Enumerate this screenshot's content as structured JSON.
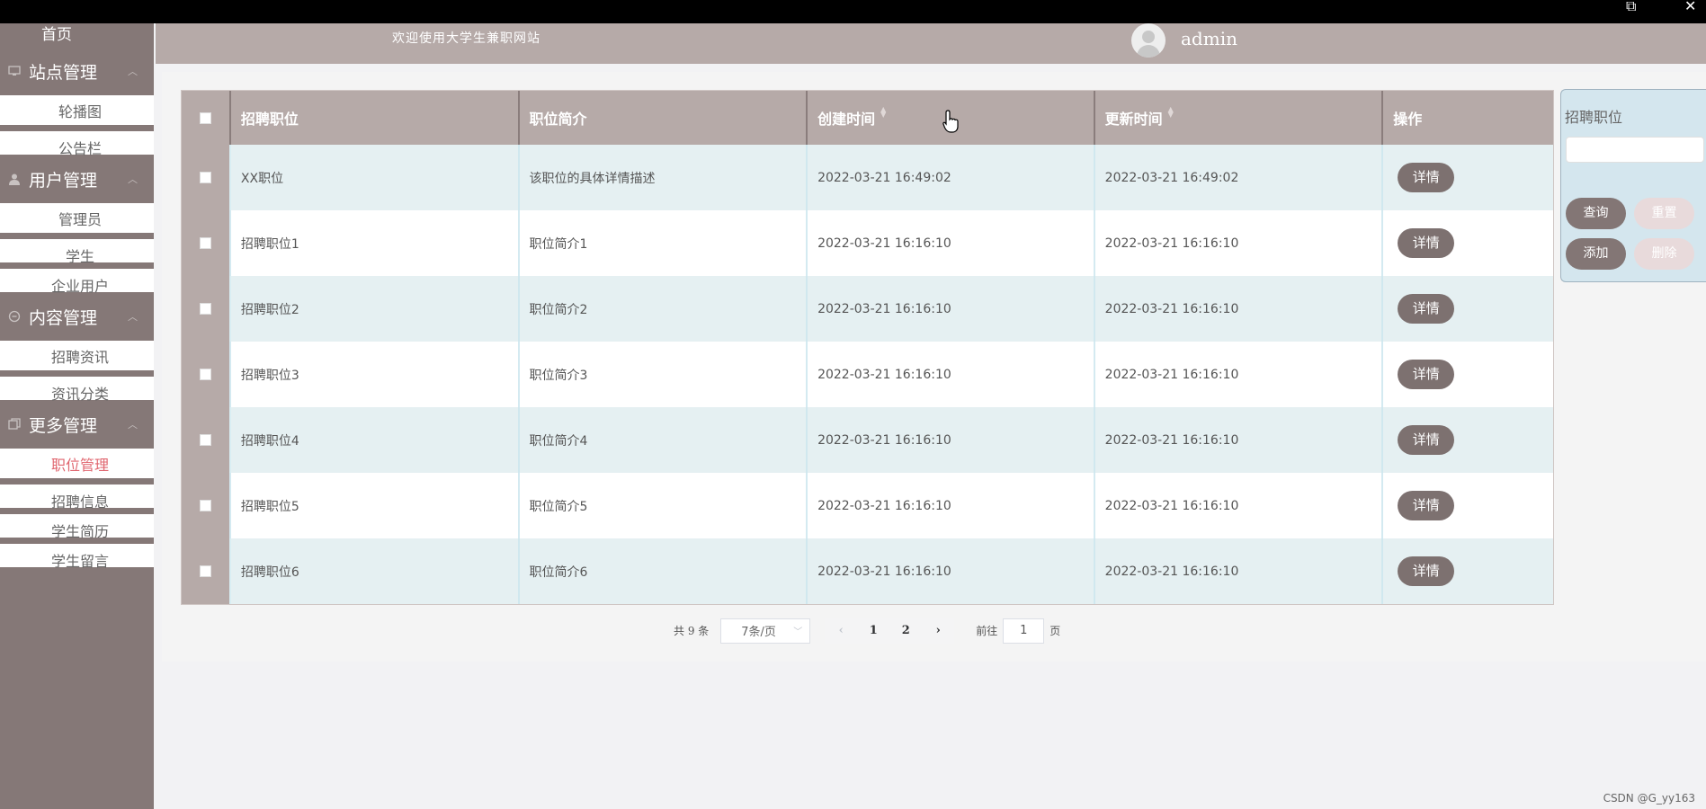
{
  "window": {
    "restore_glyph": "⧉",
    "close_glyph": "✕"
  },
  "sidebar": {
    "home": "首页",
    "groups": [
      {
        "label": "站点管理",
        "icon": "monitor-icon",
        "items": [
          "轮播图",
          "公告栏"
        ]
      },
      {
        "label": "用户管理",
        "icon": "user-icon",
        "items": [
          "管理员",
          "学生",
          "企业用户"
        ]
      },
      {
        "label": "内容管理",
        "icon": "chat-icon",
        "items": [
          "招聘资讯",
          "资讯分类"
        ]
      },
      {
        "label": "更多管理",
        "icon": "copy-icon",
        "items": [
          "职位管理",
          "招聘信息",
          "学生简历",
          "学生留言"
        ]
      }
    ],
    "active_item": "职位管理"
  },
  "header": {
    "welcome": "欢迎使用大学生兼职网站",
    "username": "admin"
  },
  "table": {
    "columns": [
      "招聘职位",
      "职位简介",
      "创建时间",
      "更新时间",
      "操作"
    ],
    "rows": [
      {
        "title": "XX职位",
        "intro": "该职位的具体详情描述",
        "created": "2022-03-21 16:49:02",
        "updated": "2022-03-21 16:49:02",
        "action": "详情"
      },
      {
        "title": "招聘职位1",
        "intro": "职位简介1",
        "created": "2022-03-21 16:16:10",
        "updated": "2022-03-21 16:16:10",
        "action": "详情"
      },
      {
        "title": "招聘职位2",
        "intro": "职位简介2",
        "created": "2022-03-21 16:16:10",
        "updated": "2022-03-21 16:16:10",
        "action": "详情"
      },
      {
        "title": "招聘职位3",
        "intro": "职位简介3",
        "created": "2022-03-21 16:16:10",
        "updated": "2022-03-21 16:16:10",
        "action": "详情"
      },
      {
        "title": "招聘职位4",
        "intro": "职位简介4",
        "created": "2022-03-21 16:16:10",
        "updated": "2022-03-21 16:16:10",
        "action": "详情"
      },
      {
        "title": "招聘职位5",
        "intro": "职位简介5",
        "created": "2022-03-21 16:16:10",
        "updated": "2022-03-21 16:16:10",
        "action": "详情"
      },
      {
        "title": "招聘职位6",
        "intro": "职位简介6",
        "created": "2022-03-21 16:16:10",
        "updated": "2022-03-21 16:16:10",
        "action": "详情"
      }
    ]
  },
  "pagination": {
    "total": "共 9 条",
    "page_size": "7条/页",
    "prev": "‹",
    "pages": [
      "1",
      "2"
    ],
    "next": "›",
    "goto_prefix": "前往",
    "goto_value": "1",
    "goto_suffix": "页"
  },
  "search": {
    "label": "招聘职位",
    "input_value": "",
    "buttons": {
      "query": "查询",
      "reset": "重置",
      "add": "添加",
      "delete": "删除"
    }
  },
  "watermark": "CSDN @G_yy163",
  "colors": {
    "sidebar": "#857877",
    "header": "#b6aaa8",
    "active": "#e0666f",
    "row_alt": "#e5f0f2",
    "search_panel": "#d4e6ee"
  }
}
